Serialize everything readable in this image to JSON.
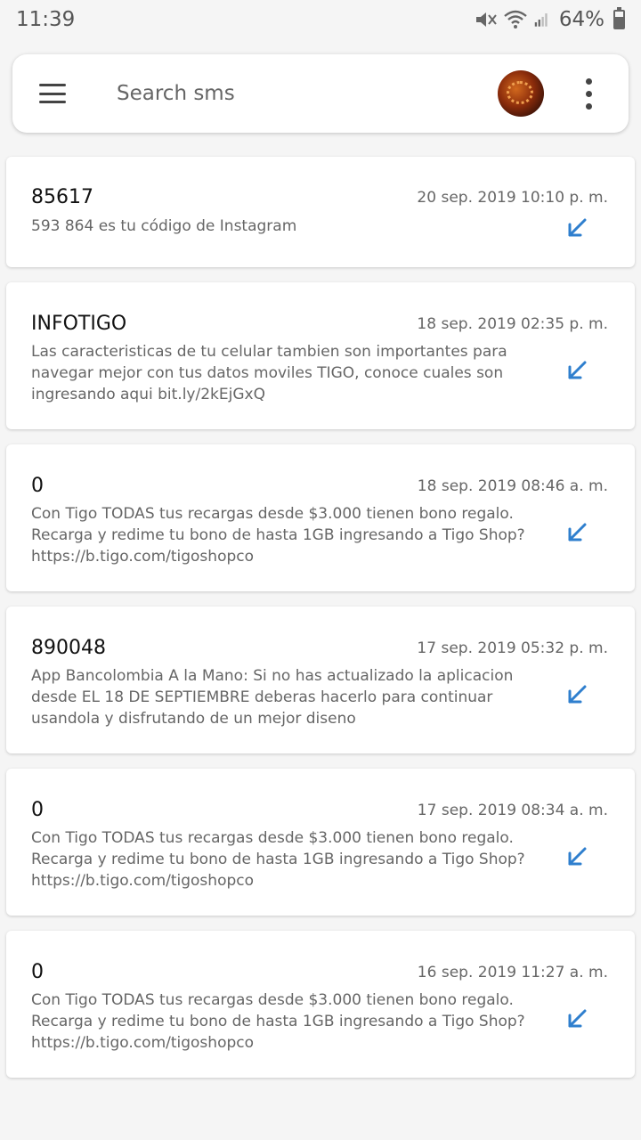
{
  "status_bar": {
    "time": "11:39",
    "battery": "64%",
    "battery_level": 0.64,
    "icons": [
      "mute-icon",
      "wifi-icon",
      "signal-icon",
      "battery-icon"
    ]
  },
  "search": {
    "placeholder": "Search sms",
    "menu_icon": "hamburger-menu-icon",
    "more_icon": "more-vertical-icon"
  },
  "colors": {
    "accent": "#2f7fce",
    "background": "#f5f5f5"
  },
  "messages": [
    {
      "sender": "85617",
      "date": "20 sep. 2019 10:10 p. m.",
      "body": "593 864 es tu código de Instagram",
      "direction_icon": "incoming-arrow-icon"
    },
    {
      "sender": "INFOTIGO",
      "date": "18 sep. 2019 02:35 p. m.",
      "body": "Las caracteristicas de tu celular tambien son importantes para navegar mejor con tus datos moviles TIGO, conoce cuales son ingresando aqui bit.ly/2kEjGxQ",
      "direction_icon": "incoming-arrow-icon"
    },
    {
      "sender": "0",
      "date": "18 sep. 2019 08:46 a. m.",
      "body": "Con Tigo TODAS tus recargas desde $3.000 tienen bono regalo. Recarga y redime tu bono de hasta 1GB ingresando a Tigo Shop?https://b.tigo.com/tigoshopco",
      "direction_icon": "incoming-arrow-icon"
    },
    {
      "sender": "890048",
      "date": "17 sep. 2019 05:32 p. m.",
      "body": "App Bancolombia A la Mano: Si no has actualizado la aplicacion desde EL 18 DE SEPTIEMBRE deberas hacerlo para continuar usandola y disfrutando de un mejor diseno",
      "direction_icon": "incoming-arrow-icon"
    },
    {
      "sender": "0",
      "date": "17 sep. 2019 08:34 a. m.",
      "body": "Con Tigo TODAS tus recargas desde $3.000 tienen bono regalo. Recarga y redime tu bono de hasta 1GB ingresando a Tigo Shop?https://b.tigo.com/tigoshopco",
      "direction_icon": "incoming-arrow-icon"
    },
    {
      "sender": "0",
      "date": "16 sep. 2019 11:27 a. m.",
      "body": "Con Tigo TODAS tus recargas desde $3.000 tienen bono regalo. Recarga y redime tu bono de hasta 1GB ingresando a Tigo Shop?https://b.tigo.com/tigoshopco",
      "direction_icon": "incoming-arrow-icon"
    }
  ]
}
